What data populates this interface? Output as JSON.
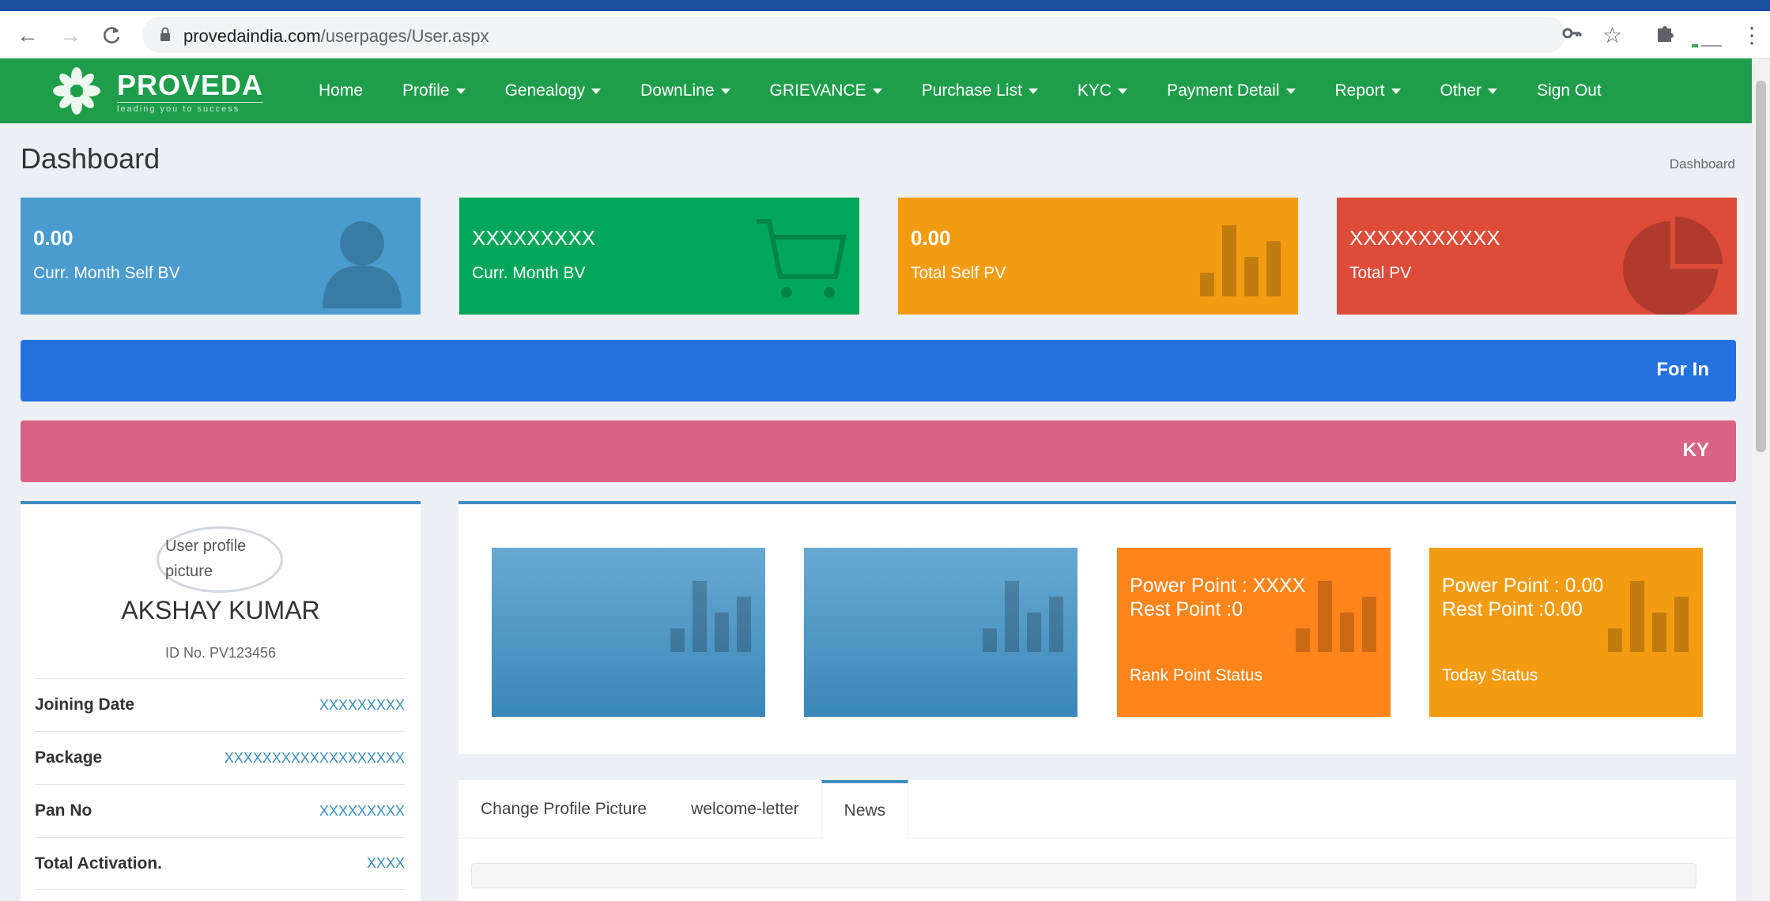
{
  "browser": {
    "url_host": "provedaindia.com",
    "url_path": "/userpages/User.aspx"
  },
  "brand": {
    "name": "PROVEDA",
    "tagline": "leading you to success"
  },
  "nav": [
    {
      "label": "Home",
      "dropdown": false
    },
    {
      "label": "Profile",
      "dropdown": true
    },
    {
      "label": "Genealogy",
      "dropdown": true
    },
    {
      "label": "DownLine",
      "dropdown": true
    },
    {
      "label": "GRIEVANCE",
      "dropdown": true
    },
    {
      "label": "Purchase List",
      "dropdown": true
    },
    {
      "label": "KYC",
      "dropdown": true
    },
    {
      "label": "Payment Detail",
      "dropdown": true
    },
    {
      "label": "Report",
      "dropdown": true
    },
    {
      "label": "Other",
      "dropdown": true
    },
    {
      "label": "Sign Out",
      "dropdown": false
    }
  ],
  "page": {
    "title": "Dashboard",
    "breadcrumb": "Dashboard"
  },
  "stats": [
    {
      "value": "0.00",
      "label": "Curr. Month Self BV",
      "color": "#4a9bce",
      "icon": "user-icon"
    },
    {
      "value": "XXXXXXXXX",
      "label": "Curr. Month BV",
      "color": "#00a65a",
      "icon": "cart-icon"
    },
    {
      "value": "0.00",
      "label": "Total Self PV",
      "color": "#f39c12",
      "icon": "bar-chart-icon"
    },
    {
      "value": "XXXXXXXXXXX",
      "label": "Total PV",
      "color": "#dd4b39",
      "icon": "pie-chart-icon"
    }
  ],
  "banners": {
    "blue": {
      "text": "For In",
      "color": "#2472e0"
    },
    "pink": {
      "text": "KY",
      "color": "#d96383"
    }
  },
  "profile": {
    "avatar_alt": "User profile picture",
    "name": "AKSHAY KUMAR",
    "id_text": "ID No. PV123456",
    "rows": [
      {
        "label": "Joining Date",
        "value": "XXXXXXXXX"
      },
      {
        "label": "Package",
        "value": "XXXXXXXXXXXXXXXXXXX"
      },
      {
        "label": "Pan No",
        "value": "XXXXXXXXX"
      },
      {
        "label": "Total Activation.",
        "value": "XXXX"
      }
    ]
  },
  "tiles": [
    {
      "line1": "",
      "line2": "",
      "footer": "",
      "color": "#4a9bce"
    },
    {
      "line1": "",
      "line2": "",
      "footer": "",
      "color": "#4a9bce"
    },
    {
      "line1": "Power Point : XXXX",
      "line2": "Rest Point :0",
      "footer": "Rank Point Status",
      "color": "#ff851b"
    },
    {
      "line1": "Power Point : 0.00",
      "line2": "Rest Point :0.00",
      "footer": "Today Status",
      "color": "#f39c12"
    }
  ],
  "tabs": [
    {
      "label": "Change Profile Picture",
      "active": false
    },
    {
      "label": "welcome-letter",
      "active": false
    },
    {
      "label": "News",
      "active": true
    }
  ]
}
